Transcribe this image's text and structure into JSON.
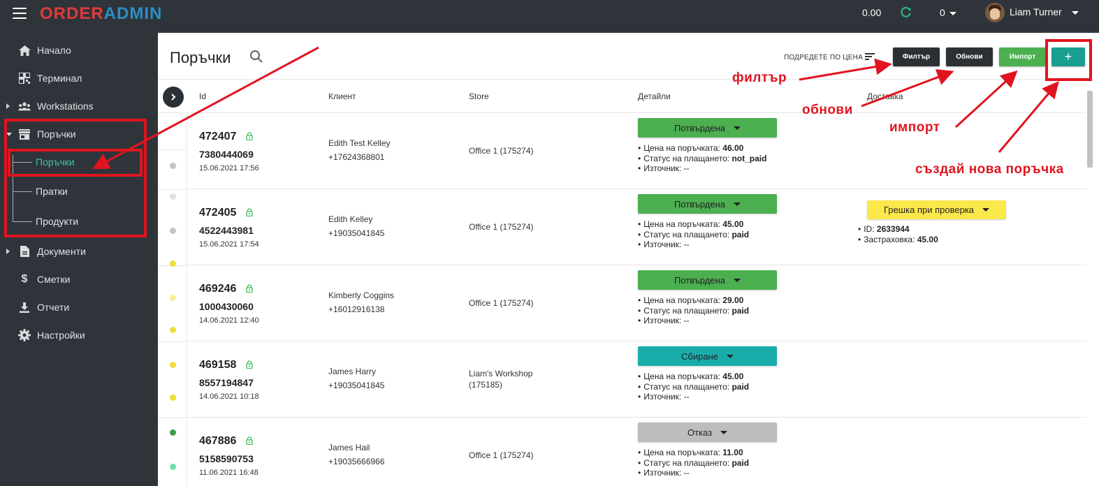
{
  "topbar": {
    "logo_part1": "ORDER",
    "logo_part2": "ADMIN",
    "balance": "0.00",
    "count": "0",
    "user_name": "Liam Turner"
  },
  "sidebar": {
    "items": [
      {
        "label": "Начало",
        "icon": "home-icon"
      },
      {
        "label": "Терминал",
        "icon": "qr-icon"
      },
      {
        "label": "Workstations",
        "icon": "group-icon"
      },
      {
        "label": "Поръчки",
        "icon": "store-icon"
      },
      {
        "label": "Документи",
        "icon": "document-icon"
      },
      {
        "label": "Сметки",
        "icon": "dollar-icon"
      },
      {
        "label": "Отчети",
        "icon": "download-icon"
      },
      {
        "label": "Настройки",
        "icon": "gear-icon"
      }
    ],
    "sub_items": [
      "Поръчки",
      "Пратки",
      "Продукти"
    ]
  },
  "page": {
    "title": "Поръчки",
    "sort_label": "ПОДРЕДЕТЕ ПО ЦЕНА",
    "btn_filter": "Филтър",
    "btn_refresh": "Обнови",
    "btn_import": "Импорт",
    "btn_add": "+"
  },
  "table": {
    "headers": [
      "Id",
      "Клиент",
      "Store",
      "Детайли",
      "Доставка"
    ],
    "detail_labels": {
      "price": "Цена на поръчката:",
      "payment": "Статус на плащането:",
      "source": "Източник:"
    },
    "rows": [
      {
        "id": "472407",
        "phone": "7380444069",
        "date": "15.06.2021 17:56",
        "client": "Edith Test Kelley",
        "client_phone": "+17624368801",
        "store": "Office 1 (175274)",
        "status": "Потвърдена",
        "status_color": "#4caf50",
        "price": "46.00",
        "payment": "not_paid",
        "source": "--"
      },
      {
        "id": "472405",
        "phone": "4522443981",
        "date": "15.06.2021 17:54",
        "client": "Edith Kelley",
        "client_phone": "+19035041845",
        "store": "Office 1 (175274)",
        "status": "Потвърдена",
        "status_color": "#4caf50",
        "price": "45.00",
        "payment": "paid",
        "source": "--",
        "delivery": {
          "status": "Грешка при проверка",
          "id_label": "ID:",
          "id": "2633944",
          "insurance_label": "Застраховка:",
          "insurance": "45.00"
        }
      },
      {
        "id": "469246",
        "phone": "1000430060",
        "date": "14.06.2021 12:40",
        "client": "Kimberly Coggins",
        "client_phone": "+16012916138",
        "store": "Office 1 (175274)",
        "status": "Потвърдена",
        "status_color": "#4caf50",
        "price": "29.00",
        "payment": "paid",
        "source": "--"
      },
      {
        "id": "469158",
        "phone": "8557194847",
        "date": "14.06.2021 10:18",
        "client": "James Harry",
        "client_phone": "+19035041845",
        "store": "Liam's Workshop (175185)",
        "status": "Сбиране",
        "status_color": "#1aacab",
        "price": "45.00",
        "payment": "paid",
        "source": "--"
      },
      {
        "id": "467886",
        "phone": "5158590753",
        "date": "11.06.2021 16:48",
        "client": "James Hail",
        "client_phone": "+19035666966",
        "store": "Office 1 (175274)",
        "status": "Отказ",
        "status_color": "#bdbdbd",
        "price": "11.00",
        "payment": "paid",
        "source": "--"
      }
    ],
    "status_dots": [
      "#c4c4c4",
      "#e2e2e2",
      "#c4c4c4",
      "#f0dc3a",
      "#f7ef9a",
      "#f0dc3a",
      "#f0dc3a",
      "#f0dc3a",
      "#3e9a4a",
      "#6fdfa8",
      "#22d36a"
    ]
  },
  "annotations": {
    "filter": "филтър",
    "refresh": "обнови",
    "import": "импорт",
    "new_order": "създай нова поръчка"
  }
}
